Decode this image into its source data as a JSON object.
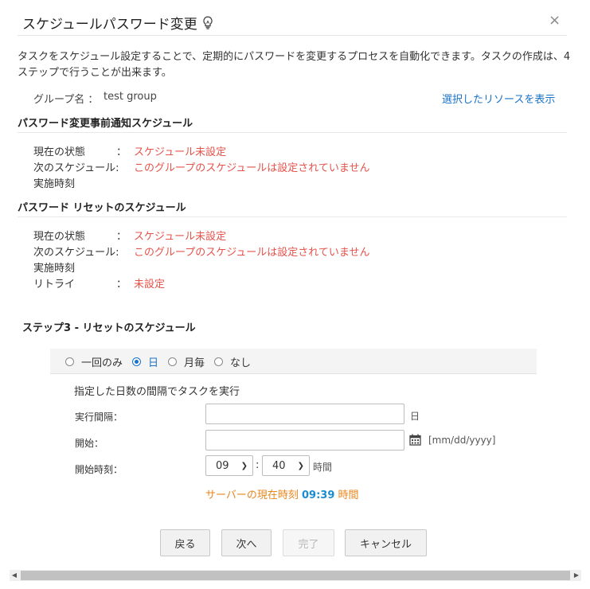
{
  "dialog": {
    "title": "スケジュールパスワード変更",
    "close": "×",
    "description": "タスクをスケジュール設定することで、定期的にパスワードを変更するプロセスを自動化できます。タスクの作成は、4ステップで行うことが出来ます。"
  },
  "group": {
    "label": "グループ名 ：",
    "value": "test group",
    "view_link": "選択したリソースを表示"
  },
  "notify_section": {
    "heading": "パスワード変更事前通知スケジュール",
    "rows": [
      {
        "label": "現在の状態",
        "colon": "：",
        "value": "スケジュール未設定"
      },
      {
        "label": "次のスケジュール:",
        "value": "このグループのスケジュールは設定されていません"
      },
      {
        "label": "実施時刻"
      }
    ]
  },
  "reset_section": {
    "heading": "パスワード リセットのスケジュール",
    "rows": [
      {
        "label": "現在の状態",
        "colon": "：",
        "value": "スケジュール未設定"
      },
      {
        "label": "次のスケジュール:",
        "value": "このグループのスケジュールは設定されていません"
      },
      {
        "label": "実施時刻"
      },
      {
        "label": "リトライ",
        "colon": "：",
        "value": "未設定"
      }
    ]
  },
  "step": {
    "title": "ステップ3 - リセットのスケジュール",
    "frequency_options": [
      {
        "label": "一回のみ",
        "checked": false
      },
      {
        "label": "日",
        "checked": true
      },
      {
        "label": "月毎",
        "checked": false
      },
      {
        "label": "なし",
        "checked": false
      }
    ],
    "instruction": "指定した日数の間隔でタスクを実行",
    "interval": {
      "label": "実行間隔：",
      "value": "",
      "unit": "日"
    },
    "start": {
      "label": "開始：",
      "value": "",
      "format": "[mm/dd/yyyy]"
    },
    "start_time": {
      "label": "開始時刻：",
      "hour": "09",
      "minute": "40",
      "separator": ":",
      "unit": "時間"
    },
    "server_time": {
      "prefix": "サーバーの現在時刻",
      "time": "09:39",
      "suffix": "時間"
    }
  },
  "buttons": {
    "back": "戻る",
    "next": "次へ",
    "finish": "完了",
    "cancel": "キャンセル"
  },
  "colors": {
    "link": "#1a73c8",
    "status_red": "#e5534b",
    "server_time_orange": "#e8861e",
    "server_time_blue": "#1a8ccf"
  }
}
